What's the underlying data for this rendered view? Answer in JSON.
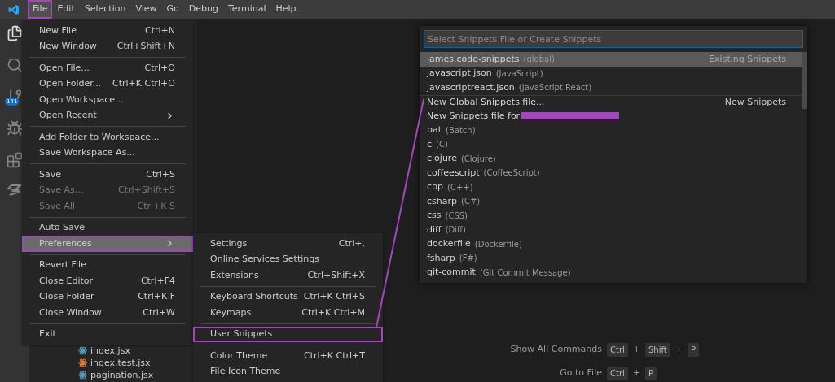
{
  "menu_bar": [
    {
      "label": "File",
      "selected": true,
      "annotated": true
    },
    {
      "label": "Edit",
      "selected": false,
      "annotated": false
    },
    {
      "label": "Selection",
      "selected": false,
      "annotated": false
    },
    {
      "label": "View",
      "selected": false,
      "annotated": false
    },
    {
      "label": "Go",
      "selected": false,
      "annotated": false
    },
    {
      "label": "Debug",
      "selected": false,
      "annotated": false
    },
    {
      "label": "Terminal",
      "selected": false,
      "annotated": false
    },
    {
      "label": "Help",
      "selected": false,
      "annotated": false
    }
  ],
  "activity_bar": {
    "source_control_badge": "141"
  },
  "file_menu": {
    "groups": [
      [
        {
          "label": "New File",
          "shortcut": "Ctrl+N",
          "disabled": false,
          "submenu": false,
          "selected": false,
          "annotated": false
        },
        {
          "label": "New Window",
          "shortcut": "Ctrl+Shift+N",
          "disabled": false,
          "submenu": false,
          "selected": false,
          "annotated": false
        }
      ],
      [
        {
          "label": "Open File...",
          "shortcut": "Ctrl+O",
          "disabled": false,
          "submenu": false,
          "selected": false,
          "annotated": false
        },
        {
          "label": "Open Folder...",
          "shortcut": "Ctrl+K Ctrl+O",
          "disabled": false,
          "submenu": false,
          "selected": false,
          "annotated": false
        },
        {
          "label": "Open Workspace...",
          "disabled": false,
          "submenu": false,
          "selected": false,
          "annotated": false
        },
        {
          "label": "Open Recent",
          "disabled": false,
          "submenu": true,
          "selected": false,
          "annotated": false
        }
      ],
      [
        {
          "label": "Add Folder to Workspace...",
          "disabled": false,
          "submenu": false,
          "selected": false,
          "annotated": false
        },
        {
          "label": "Save Workspace As...",
          "disabled": false,
          "submenu": false,
          "selected": false,
          "annotated": false
        }
      ],
      [
        {
          "label": "Save",
          "shortcut": "Ctrl+S",
          "disabled": false,
          "submenu": false,
          "selected": false,
          "annotated": false
        },
        {
          "label": "Save As...",
          "shortcut": "Ctrl+Shift+S",
          "disabled": true,
          "submenu": false,
          "selected": false,
          "annotated": false
        },
        {
          "label": "Save All",
          "shortcut": "Ctrl+K S",
          "disabled": true,
          "submenu": false,
          "selected": false,
          "annotated": false
        }
      ],
      [
        {
          "label": "Auto Save",
          "disabled": false,
          "submenu": false,
          "selected": false,
          "annotated": false
        },
        {
          "label": "Preferences",
          "disabled": false,
          "submenu": true,
          "selected": true,
          "annotated": true
        }
      ],
      [
        {
          "label": "Revert File",
          "disabled": false,
          "submenu": false,
          "selected": false,
          "annotated": false
        },
        {
          "label": "Close Editor",
          "shortcut": "Ctrl+F4",
          "disabled": false,
          "submenu": false,
          "selected": false,
          "annotated": false
        },
        {
          "label": "Close Folder",
          "shortcut": "Ctrl+K F",
          "disabled": false,
          "submenu": false,
          "selected": false,
          "annotated": false
        },
        {
          "label": "Close Window",
          "shortcut": "Ctrl+W",
          "disabled": false,
          "submenu": false,
          "selected": false,
          "annotated": false
        }
      ],
      [
        {
          "label": "Exit",
          "disabled": false,
          "submenu": false,
          "selected": false,
          "annotated": false
        }
      ]
    ]
  },
  "preferences_menu": {
    "groups": [
      [
        {
          "label": "Settings",
          "shortcut": "Ctrl+,",
          "selected": false,
          "annotated": false
        },
        {
          "label": "Online Services Settings",
          "selected": false,
          "annotated": false
        },
        {
          "label": "Extensions",
          "shortcut": "Ctrl+Shift+X",
          "selected": false,
          "annotated": false
        }
      ],
      [
        {
          "label": "Keyboard Shortcuts",
          "shortcut": "Ctrl+K Ctrl+S",
          "selected": false,
          "annotated": false
        },
        {
          "label": "Keymaps",
          "shortcut": "Ctrl+K Ctrl+M",
          "selected": false,
          "annotated": false
        }
      ],
      [
        {
          "label": "User Snippets",
          "selected": false,
          "annotated": true
        }
      ],
      [
        {
          "label": "Color Theme",
          "shortcut": "Ctrl+K Ctrl+T",
          "selected": false,
          "annotated": false
        },
        {
          "label": "File Icon Theme",
          "selected": false,
          "annotated": false
        }
      ]
    ]
  },
  "explorer": {
    "files": [
      {
        "name": "index.jsx",
        "color": "#519aba"
      },
      {
        "name": "index.test.jsx",
        "color": "#e37933"
      },
      {
        "name": "pagination.jsx",
        "color": "#519aba"
      }
    ]
  },
  "quick_pick": {
    "placeholder": "Select Snippets File or Create Snippets",
    "items": [
      {
        "label": "james.code-snippets",
        "detail": "(global)",
        "group_label": "Existing Snippets",
        "selected": true,
        "separator": false,
        "redacted": false
      },
      {
        "label": "javascript.json",
        "detail": "(JavaScript)",
        "selected": false,
        "separator": false,
        "redacted": false
      },
      {
        "label": "javascriptreact.json",
        "detail": "(JavaScript React)",
        "selected": false,
        "separator": false,
        "redacted": false
      },
      {
        "label": "New Global Snippets file...",
        "group_label": "New Snippets",
        "selected": false,
        "separator": true,
        "redacted": false
      },
      {
        "label": "New Snippets file for",
        "selected": false,
        "separator": false,
        "redacted": true
      },
      {
        "label": "bat",
        "detail": "(Batch)",
        "selected": false,
        "separator": false,
        "redacted": false
      },
      {
        "label": "c",
        "detail": "(C)",
        "selected": false,
        "separator": false,
        "redacted": false
      },
      {
        "label": "clojure",
        "detail": "(Clojure)",
        "selected": false,
        "separator": false,
        "redacted": false
      },
      {
        "label": "coffeescript",
        "detail": "(CoffeeScript)",
        "selected": false,
        "separator": false,
        "redacted": false
      },
      {
        "label": "cpp",
        "detail": "(C++)",
        "selected": false,
        "separator": false,
        "redacted": false
      },
      {
        "label": "csharp",
        "detail": "(C#)",
        "selected": false,
        "separator": false,
        "redacted": false
      },
      {
        "label": "css",
        "detail": "(CSS)",
        "selected": false,
        "separator": false,
        "redacted": false
      },
      {
        "label": "diff",
        "detail": "(Diff)",
        "selected": false,
        "separator": false,
        "redacted": false
      },
      {
        "label": "dockerfile",
        "detail": "(Dockerfile)",
        "selected": false,
        "separator": false,
        "redacted": false
      },
      {
        "label": "fsharp",
        "detail": "(F#)",
        "selected": false,
        "separator": false,
        "redacted": false
      },
      {
        "label": "git-commit",
        "detail": "(Git Commit Message)",
        "selected": false,
        "separator": false,
        "redacted": false
      }
    ]
  },
  "welcome_shortcuts": [
    {
      "label": "Show All Commands",
      "keys": [
        "Ctrl",
        "+",
        "Shift",
        "+",
        "P"
      ]
    },
    {
      "label": "Go to File",
      "keys": [
        "Ctrl",
        "+",
        "P"
      ]
    }
  ]
}
